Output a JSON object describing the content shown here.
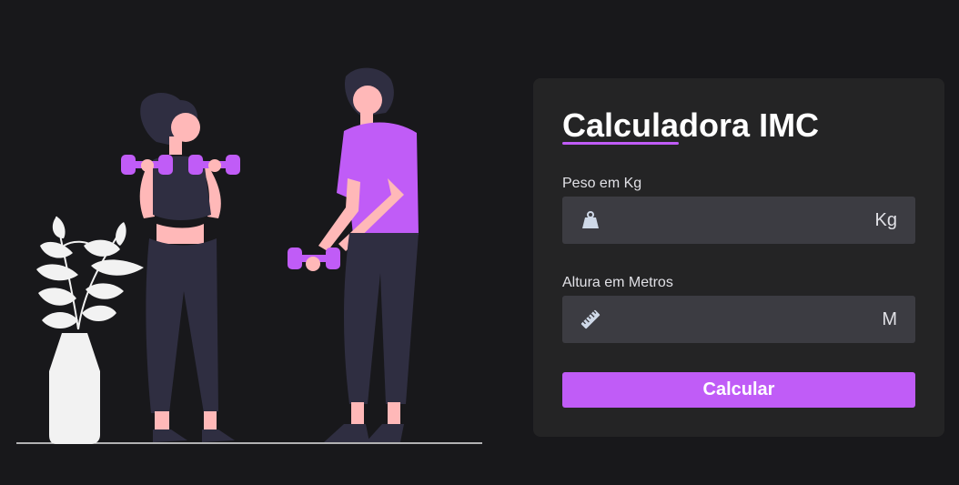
{
  "colors": {
    "background": "#18181b",
    "card": "#242425",
    "input": "#3c3c42",
    "accent": "#c05cf7",
    "text": "#e1e1e6",
    "title": "#ffffff"
  },
  "illustration": {
    "name": "fitness-illustration",
    "icons": [
      "plant-vase",
      "woman-with-dumbbells",
      "man-with-dumbbell"
    ]
  },
  "card": {
    "title": "Calculadora IMC",
    "weight": {
      "label": "Peso em Kg",
      "value": "",
      "unit": "Kg",
      "icon": "weight-icon"
    },
    "height": {
      "label": "Altura em Metros",
      "value": "",
      "unit": "M",
      "icon": "ruler-icon"
    },
    "button_label": "Calcular"
  }
}
